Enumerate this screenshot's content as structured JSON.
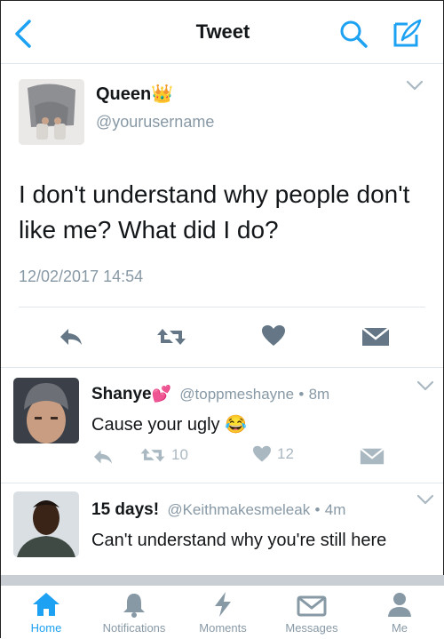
{
  "header": {
    "title": "Tweet",
    "back_icon": "chevron-left-icon",
    "search_icon": "search-icon",
    "compose_icon": "compose-icon"
  },
  "tweet": {
    "display_name": "Queen",
    "display_emoji": "👑",
    "handle": "@yourusername",
    "text": "I don't understand why people don't like me? What did I do?",
    "timestamp": "12/02/2017 14:54"
  },
  "replies": [
    {
      "display_name": "Shanye",
      "display_emoji": "💕",
      "handle": "@toppmeshayne",
      "dot": "•",
      "time": "8m",
      "text": "Cause your ugly 😂",
      "retweets": "10",
      "likes": "12"
    },
    {
      "display_name": "15 days!",
      "handle": "@Keithmakesmeleak",
      "dot": "•",
      "time": "4m",
      "text": "Can't understand why you're still here"
    }
  ],
  "tabs": [
    {
      "label": "Home",
      "icon": "home-icon",
      "active": true
    },
    {
      "label": "Notifications",
      "icon": "bell-icon",
      "active": false
    },
    {
      "label": "Moments",
      "icon": "lightning-icon",
      "active": false
    },
    {
      "label": "Messages",
      "icon": "envelope-icon",
      "active": false
    },
    {
      "label": "Me",
      "icon": "person-icon",
      "active": false
    }
  ],
  "colors": {
    "accent": "#1da1f2",
    "muted": "#8899a6",
    "text": "#14171a"
  }
}
